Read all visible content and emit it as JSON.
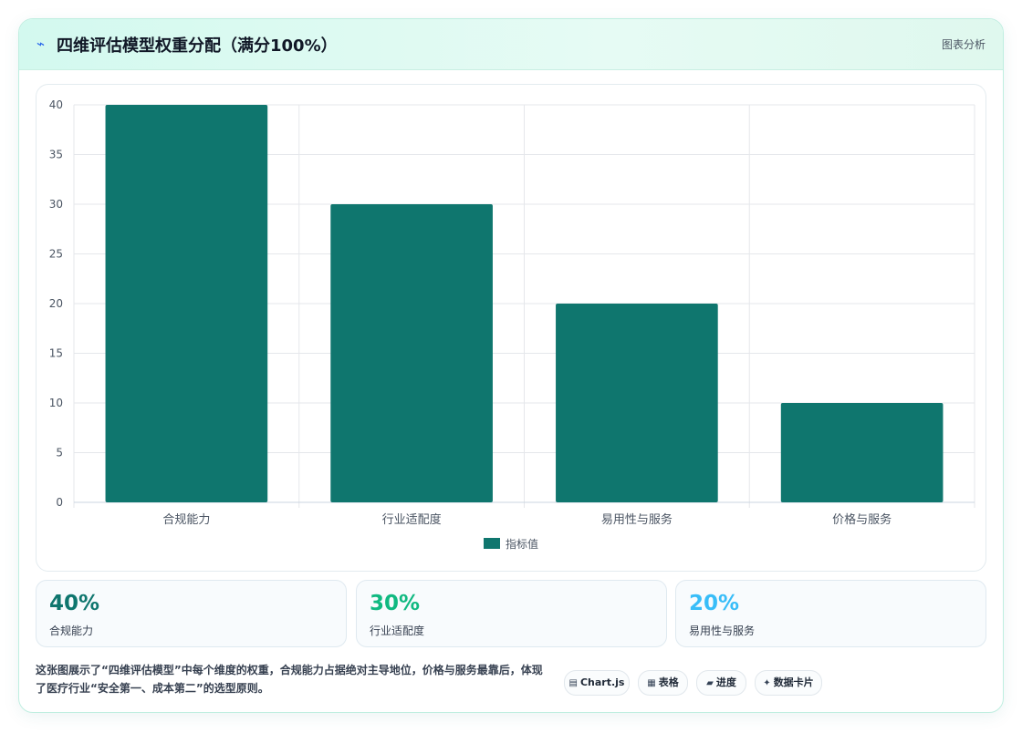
{
  "header": {
    "icon": "⌁",
    "title": "四维评估模型权重分配（满分100%）",
    "link_label": "图表分析"
  },
  "chart_data": {
    "type": "bar",
    "categories": [
      "合规能力",
      "行业适配度",
      "易用性与服务",
      "价格与服务"
    ],
    "series": [
      {
        "name": "指标值",
        "values": [
          40,
          30,
          20,
          10
        ],
        "color": "#0f766e"
      }
    ],
    "ylim": [
      0,
      40
    ],
    "yticks": [
      0,
      5,
      10,
      15,
      20,
      25,
      30,
      35,
      40
    ],
    "grid": true,
    "legend_position": "bottom"
  },
  "stats": [
    {
      "value": "40%",
      "label": "合规能力",
      "color": "#0f766e"
    },
    {
      "value": "30%",
      "label": "行业适配度",
      "color": "#10b981"
    },
    {
      "value": "20%",
      "label": "易用性与服务",
      "color": "#38bdf8"
    }
  ],
  "footer": {
    "description": "这张图展示了“四维评估模型”中每个维度的权重，合规能力占据绝对主导地位，价格与服务最靠后，体现了医疗行业“安全第一、成本第二”的选型原则。"
  },
  "tags": [
    {
      "icon": "▤",
      "label": "Chart.js",
      "icon_name": "chart-icon"
    },
    {
      "icon": "▦",
      "label": "表格",
      "icon_name": "table-icon"
    },
    {
      "icon": "▰",
      "label": "进度",
      "icon_name": "progress-icon"
    },
    {
      "icon": "✦",
      "label": "数据卡片",
      "icon_name": "sparkle-icon"
    }
  ],
  "colors": {
    "accent": "#0f766e",
    "grid": "#e5e7eb",
    "text": "#4b5563"
  }
}
